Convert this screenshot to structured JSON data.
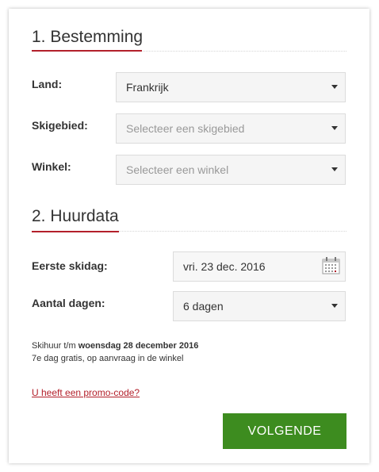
{
  "section1": {
    "title": "1. Bestemming"
  },
  "land": {
    "label": "Land:",
    "value": "Frankrijk"
  },
  "skigebied": {
    "label": "Skigebied:",
    "placeholder": "Selecteer een skigebied"
  },
  "winkel": {
    "label": "Winkel:",
    "placeholder": "Selecteer een winkel"
  },
  "section2": {
    "title": "2. Huurdata"
  },
  "eerste_skidag": {
    "label": "Eerste skidag:",
    "value": "vri. 23 dec. 2016",
    "icon": "calendar-icon"
  },
  "aantal_dagen": {
    "label": "Aantal dagen:",
    "value": "6 dagen"
  },
  "summary": {
    "prefix": "Skihuur t/m ",
    "date": "woensdag 28 december 2016",
    "note": "7e dag gratis, op aanvraag in de winkel"
  },
  "promo_link": "U heeft een promo-code?",
  "next_button": "VOLGENDE",
  "colors": {
    "accent_red": "#b3202b",
    "button_green": "#3d8c1f"
  }
}
